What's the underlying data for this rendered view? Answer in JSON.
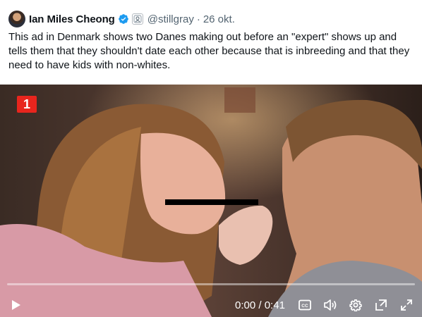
{
  "tweet": {
    "author": {
      "display_name": "Ian Miles Cheong",
      "handle": "@stillgray",
      "verified": true,
      "avatar_icon": "avatar-photo"
    },
    "separator": "·",
    "date": "26 okt.",
    "text": "This ad in Denmark shows two Danes making out before an \"expert\" shows up and tells them that they shouldn't date each other because that is inbreeding and that they need to have kids with non-whites."
  },
  "media": {
    "type": "video",
    "channel_logo": "1",
    "channel_logo_color": "#e8251d",
    "player": {
      "current_time": "0:00",
      "time_separator": " / ",
      "duration": "0:41",
      "progress": 0,
      "controls": [
        "play-icon",
        "captions-icon",
        "volume-icon",
        "settings-icon",
        "pop-out-icon",
        "fullscreen-icon"
      ]
    }
  },
  "colors": {
    "text": "#0f1419",
    "secondary": "#536471",
    "verified": "#1d9bf0"
  }
}
